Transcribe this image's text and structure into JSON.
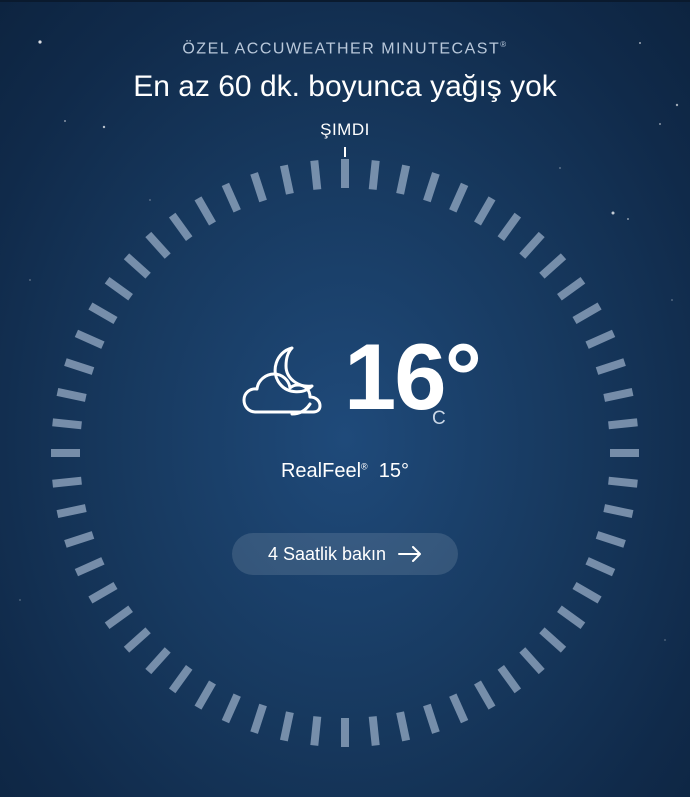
{
  "header": {
    "label": "ÖZEL ACCUWEATHER MINUTECAST",
    "label_mark": "®",
    "headline": "En az 60 dk. boyunca yağış yok"
  },
  "dial": {
    "now_label": "ŞIMDI",
    "minutes_without_precipitation": 60
  },
  "current": {
    "icon": "partly-cloudy-night-icon",
    "temperature": "16°",
    "unit": "C",
    "realfeel_label": "RealFeel",
    "realfeel_mark": "®",
    "realfeel_value": "15°"
  },
  "cta": {
    "label": "4 Saatlik bakın",
    "icon": "arrow-right-icon"
  },
  "colors": {
    "background": "#17395f",
    "tick": "#9fb3cc",
    "text": "#ffffff",
    "button_bg": "rgba(255,255,255,0.12)"
  }
}
